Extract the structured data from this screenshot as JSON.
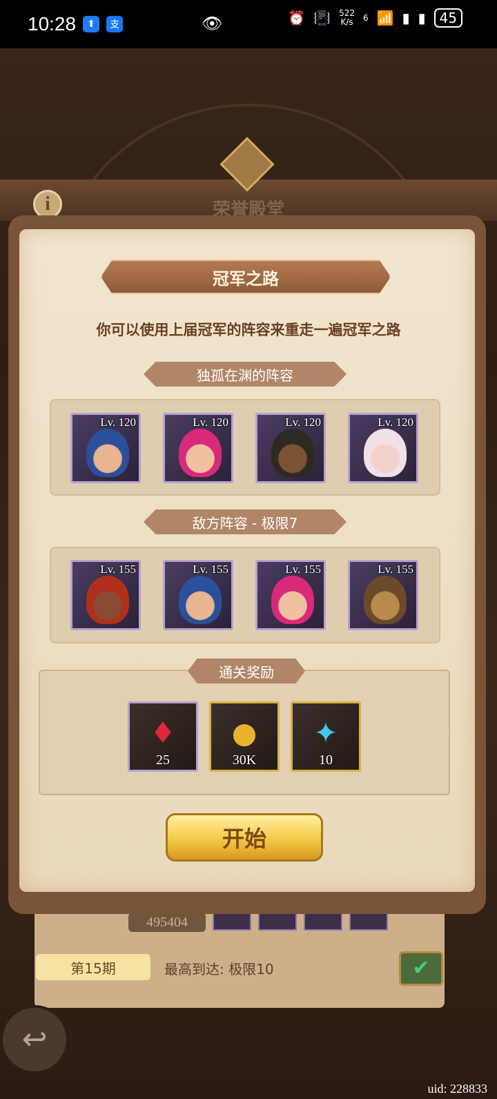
{
  "status_bar": {
    "time": "10:28",
    "app_badge_2": "支",
    "net_speed_value": "522",
    "net_speed_unit": "K/s",
    "network": "6",
    "battery": "45"
  },
  "background": {
    "hall_title": "荣誉殿堂",
    "info_label": "i",
    "score": "495404",
    "period": "第15期",
    "best_reach": "最高到达: 极限10",
    "uid": "uid: 228833"
  },
  "dialog": {
    "title": "冠军之路",
    "description": "你可以使用上届冠军的阵容来重走一遍冠军之路",
    "champion_section": "独孤在渊的阵容",
    "champion_team": [
      {
        "level": "Lv. 120",
        "hair": "#2b4f9a",
        "skin": "#e8b590"
      },
      {
        "level": "Lv. 120",
        "hair": "#d9297a",
        "skin": "#f0c0a0"
      },
      {
        "level": "Lv. 120",
        "hair": "#2d2a22",
        "skin": "#7a5234"
      },
      {
        "level": "Lv. 120",
        "hair": "#f1e0e6",
        "skin": "#f3d2cc"
      }
    ],
    "enemy_section": "敌方阵容 - 极限7",
    "enemy_team": [
      {
        "level": "Lv. 155",
        "hair": "#b0301c",
        "skin": "#8a4a34"
      },
      {
        "level": "Lv. 155",
        "hair": "#2b4f9a",
        "skin": "#e8b590"
      },
      {
        "level": "Lv. 155",
        "hair": "#d9297a",
        "skin": "#f0c0a0"
      },
      {
        "level": "Lv. 155",
        "hair": "#6b4a2a",
        "skin": "#b88a4c"
      }
    ],
    "reward_section": "通关奖励",
    "rewards": [
      {
        "icon": "gem-icon",
        "glyph": "♦",
        "count": "25"
      },
      {
        "icon": "gold-coin-icon",
        "glyph": "●",
        "count": "30K"
      },
      {
        "icon": "crystal-icon",
        "glyph": "✦",
        "count": "10"
      }
    ],
    "start_label": "开始"
  }
}
